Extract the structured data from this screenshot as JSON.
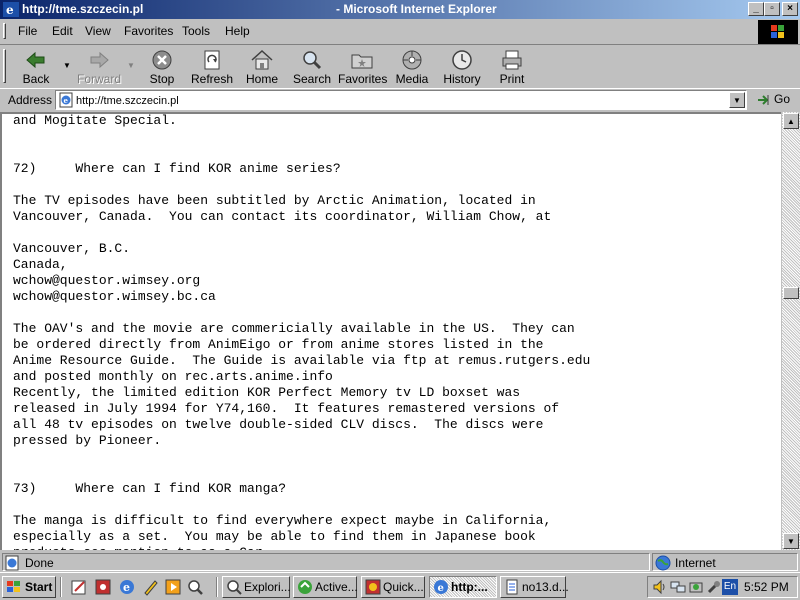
{
  "window": {
    "title_url": "http://tme.szczecin.pl",
    "title_app": "- Microsoft Internet Explorer",
    "min_label": "_",
    "max_label": "▫",
    "close_label": "×"
  },
  "menu": [
    "File",
    "Edit",
    "View",
    "Favorites",
    "Tools",
    "Help"
  ],
  "toolbar": {
    "back": "Back",
    "forward": "Forward",
    "stop": "Stop",
    "refresh": "Refresh",
    "home": "Home",
    "search": "Search",
    "favorites": "Favorites",
    "media": "Media",
    "history": "History",
    "print": "Print"
  },
  "address": {
    "label": "Address",
    "url": "http://tme.szczecin.pl",
    "go_label": "Go"
  },
  "content": {
    "text": "and Mogitate Special.\n\n\n72)     Where can I find KOR anime series?\n\nThe TV episodes have been subtitled by Arctic Animation, located in\nVancouver, Canada.  You can contact its coordinator, William Chow, at\n\nVancouver, B.C.\nCanada,\nwchow@questor.wimsey.org\nwchow@questor.wimsey.bc.ca\n\nThe OAV's and the movie are commericially available in the US.  They can\nbe ordered directly from AnimEigo or from anime stores listed in the\nAnime Resource Guide.  The Guide is available via ftp at remus.rutgers.edu\nand posted monthly on rec.arts.anime.info\nRecently, the limited edition KOR Perfect Memory tv LD boxset was\nreleased in July 1994 for Y74,160.  It features remastered versions of\nall 48 tv episodes on twelve double-sided CLV discs.  The discs were\npressed by Pioneer.\n\n\n73)     Where can I find KOR manga?\n\nThe manga is difficult to find everywhere expect maybe in California,\nespecially as a set.  You may be able to find them in Japanese book\nproducts sec mention to as a Gar..."
  },
  "status": {
    "text": "Done",
    "zone": "Internet"
  },
  "taskbar": {
    "start": "Start",
    "tasks": [
      {
        "label": "Explori..."
      },
      {
        "label": "Active..."
      },
      {
        "label": "Quick..."
      },
      {
        "label": "http:..."
      },
      {
        "label": "no13.d..."
      }
    ],
    "lang": "En",
    "clock": "5:52 PM"
  },
  "scroll": {
    "position_fraction": 0.4
  }
}
